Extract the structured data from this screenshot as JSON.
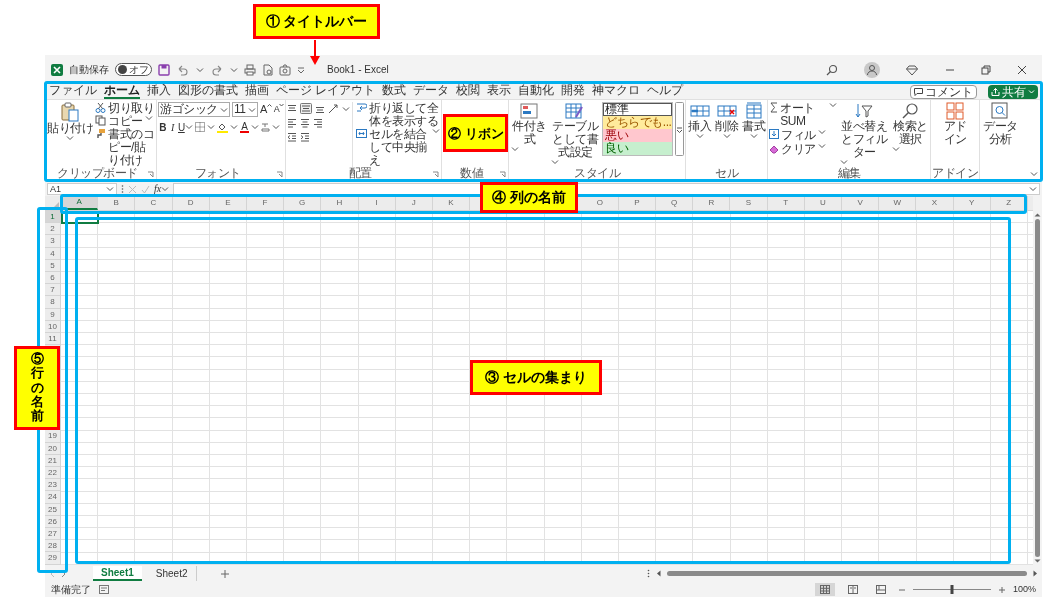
{
  "annotations": [
    {
      "text": "① タイトルバー",
      "kind": "horizontal"
    },
    {
      "text": "② リボン",
      "kind": "horizontal"
    },
    {
      "text": "④ 列の名前",
      "kind": "horizontal"
    },
    {
      "text": "⑤行の名前",
      "kind": "vertical"
    },
    {
      "text": "③ セルの集まり",
      "kind": "horizontal"
    }
  ],
  "title_bar": {
    "autosave_label": "自動保存",
    "autosave_toggle": {
      "text": "オフ",
      "on": false
    },
    "title": "Book1 - Excel"
  },
  "ribbon_tabs": [
    {
      "label": "ファイル",
      "selected": false
    },
    {
      "label": "ホーム",
      "selected": true
    },
    {
      "label": "挿入",
      "selected": false
    },
    {
      "label": "図形の書式",
      "selected": false
    },
    {
      "label": "描画",
      "selected": false
    },
    {
      "label": "ページ レイアウト",
      "selected": false
    },
    {
      "label": "数式",
      "selected": false
    },
    {
      "label": "データ",
      "selected": false
    },
    {
      "label": "校閲",
      "selected": false
    },
    {
      "label": "表示",
      "selected": false
    },
    {
      "label": "自動化",
      "selected": false
    },
    {
      "label": "開発",
      "selected": false
    },
    {
      "label": "神マクロ",
      "selected": false
    },
    {
      "label": "ヘルプ",
      "selected": false
    }
  ],
  "comment_button": "コメント",
  "share_button": "共有",
  "clipboard": {
    "paste": "貼り付け",
    "cut": "切り取り",
    "copy": "コピー",
    "format_painter": "書式のコピー/貼り付け",
    "label": "クリップボード"
  },
  "font": {
    "name": "游ゴシック",
    "size": "11",
    "grow": "A",
    "shrink": "A",
    "bold": "B",
    "italic": "I",
    "underline": "U",
    "font_color_button": "A",
    "label": "フォント"
  },
  "alignment": {
    "wrap": "折り返して全体を表示する",
    "merge": "セルを結合して中央揃え",
    "label": "配置"
  },
  "number": {
    "label": "数値"
  },
  "styles": {
    "conditional": "件付き式",
    "table": "テーブルとして書式設定",
    "gallery": [
      {
        "text": "標準",
        "kind": "normal"
      },
      {
        "text": "どちらでも...",
        "kind": "neutral"
      },
      {
        "text": "悪い",
        "kind": "bad"
      },
      {
        "text": "良い",
        "kind": "good"
      }
    ],
    "label": "スタイル"
  },
  "cells": {
    "buttons": [
      {
        "text": "挿入",
        "kind": "insert"
      },
      {
        "text": "削除",
        "kind": "delete"
      },
      {
        "text": "書式",
        "kind": "format"
      }
    ],
    "label": "セル"
  },
  "editing": {
    "autosum": "オート SUM",
    "fill": "フィル",
    "clear": "クリア",
    "sort": "並べ替えとフィルター",
    "find": "検索と選択",
    "label": "編集"
  },
  "addins": {
    "button": "アドイン",
    "label": "アドイン"
  },
  "data_analysis": "データ分析",
  "formula_bar": {
    "name_box": "A1",
    "function_button": "fx"
  },
  "columns_left": [
    {
      "label": "A",
      "selected": true
    },
    {
      "label": "B",
      "selected": false
    },
    {
      "label": "C",
      "selected": false
    },
    {
      "label": "D",
      "selected": false
    },
    {
      "label": "E",
      "selected": false
    },
    {
      "label": "F",
      "selected": false
    },
    {
      "label": "G",
      "selected": false
    },
    {
      "label": "H",
      "selected": false
    },
    {
      "label": "I",
      "selected": false
    },
    {
      "label": "J",
      "selected": false
    },
    {
      "label": "K",
      "selected": false
    }
  ],
  "columns_right": [
    {
      "label": "O",
      "selected": false
    },
    {
      "label": "P",
      "selected": false
    },
    {
      "label": "Q",
      "selected": false
    },
    {
      "label": "R",
      "selected": false
    },
    {
      "label": "S",
      "selected": false
    },
    {
      "label": "T",
      "selected": false
    },
    {
      "label": "U",
      "selected": false
    },
    {
      "label": "V",
      "selected": false
    },
    {
      "label": "W",
      "selected": false
    },
    {
      "label": "X",
      "selected": false
    },
    {
      "label": "Y",
      "selected": false
    },
    {
      "label": "Z",
      "selected": false
    }
  ],
  "rows_top": [
    {
      "label": "1",
      "selected": true
    },
    {
      "label": "2",
      "selected": false
    },
    {
      "label": "3",
      "selected": false
    },
    {
      "label": "4",
      "selected": false
    },
    {
      "label": "5",
      "selected": false
    },
    {
      "label": "6",
      "selected": false
    },
    {
      "label": "7",
      "selected": false
    },
    {
      "label": "8",
      "selected": false
    },
    {
      "label": "9",
      "selected": false
    },
    {
      "label": "10",
      "selected": false
    },
    {
      "label": "11",
      "selected": false
    }
  ],
  "rows_bottom": [
    {
      "label": "19",
      "selected": false
    },
    {
      "label": "20",
      "selected": false
    },
    {
      "label": "21",
      "selected": false
    },
    {
      "label": "22",
      "selected": false
    },
    {
      "label": "23",
      "selected": false
    },
    {
      "label": "24",
      "selected": false
    },
    {
      "label": "25",
      "selected": false
    },
    {
      "label": "26",
      "selected": false
    },
    {
      "label": "27",
      "selected": false
    },
    {
      "label": "28",
      "selected": false
    },
    {
      "label": "29",
      "selected": false
    }
  ],
  "sheets": [
    {
      "name": "Sheet1",
      "selected": true
    },
    {
      "name": "Sheet2",
      "selected": false
    }
  ],
  "status_bar": {
    "text": "準備完了",
    "views": [
      {
        "kind": "normal",
        "selected": true
      },
      {
        "kind": "page_layout",
        "selected": false
      },
      {
        "kind": "page_break",
        "selected": false
      }
    ],
    "zoom": {
      "level": 0.5
    },
    "zoom_text": "100%"
  }
}
